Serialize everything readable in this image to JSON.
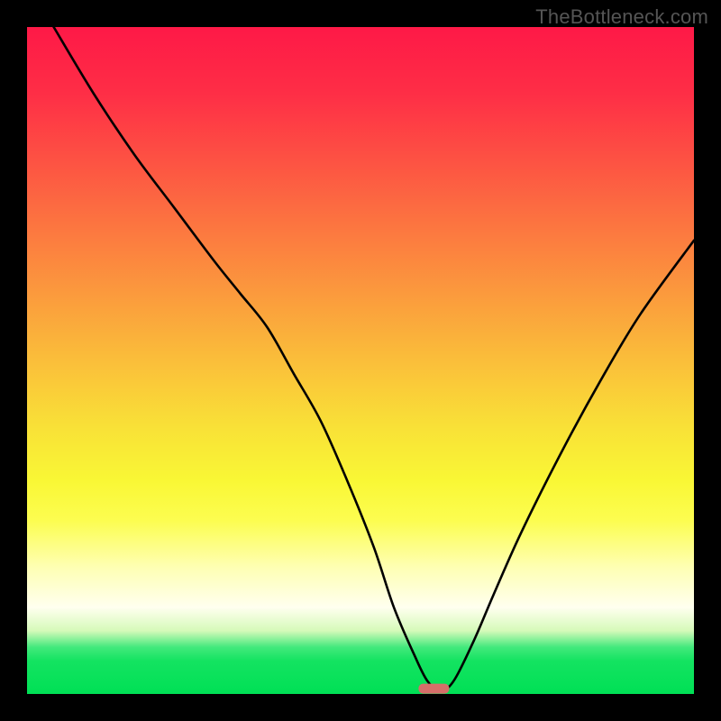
{
  "watermark": "TheBottleneck.com",
  "chart_data": {
    "type": "line",
    "title": "",
    "xlabel": "",
    "ylabel": "",
    "xlim": [
      0,
      100
    ],
    "ylim": [
      0,
      100
    ],
    "series": [
      {
        "name": "bottleneck-curve",
        "x": [
          4,
          10,
          16,
          22,
          28,
          32,
          36,
          40,
          44,
          48,
          52,
          55,
          58,
          60,
          62,
          64,
          67,
          70,
          74,
          80,
          86,
          92,
          100
        ],
        "y": [
          100,
          90,
          81,
          73,
          65,
          60,
          55,
          48,
          41,
          32,
          22,
          13,
          6,
          2,
          0.5,
          2,
          8,
          15,
          24,
          36,
          47,
          57,
          68
        ]
      }
    ],
    "marker": {
      "x": 61,
      "y": 0.8,
      "label": "optimal-point"
    },
    "background_gradient": {
      "top": "#fe1947",
      "mid": "#fabe3a",
      "bottom": "#00e055"
    },
    "colors": {
      "curve": "#000000",
      "marker": "#d56e69"
    }
  }
}
